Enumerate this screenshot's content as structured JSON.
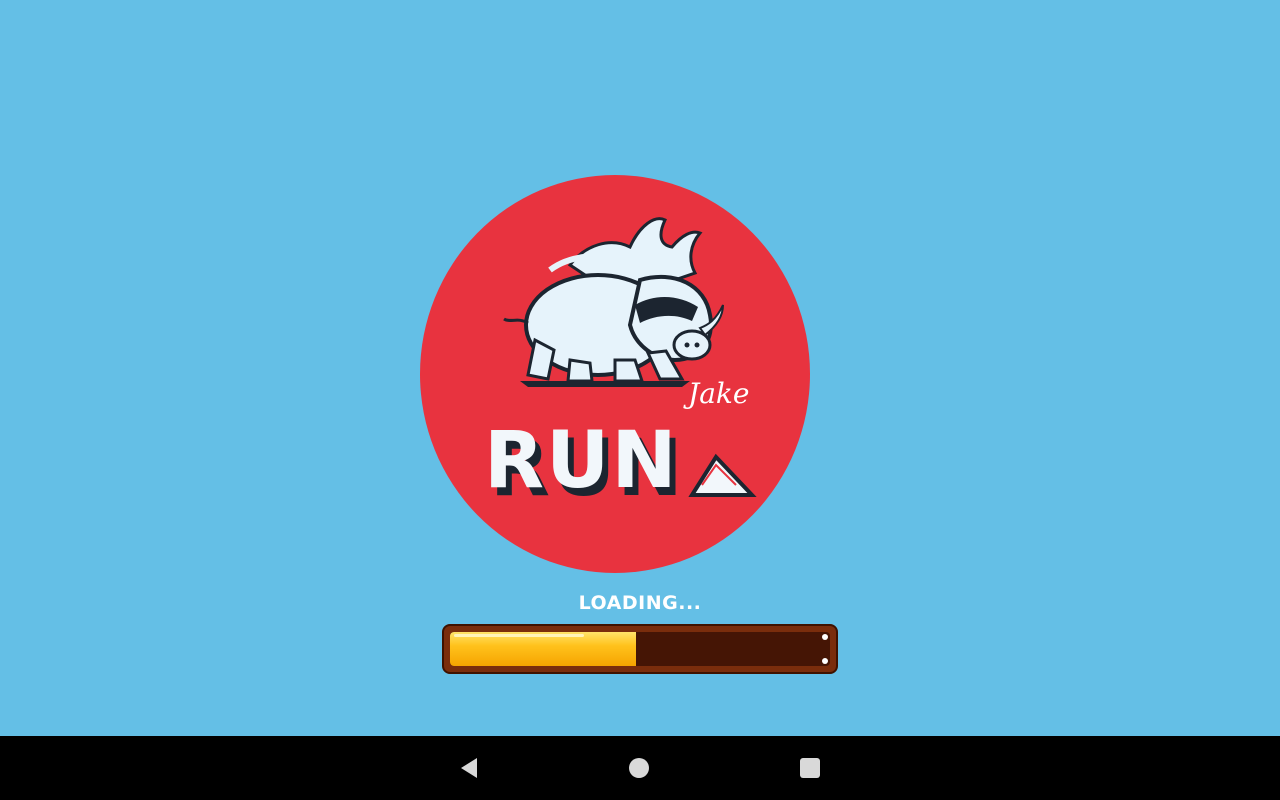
{
  "logo": {
    "title": "RUN",
    "subtitle": "Jake"
  },
  "loading": {
    "label": "LOADING...",
    "progress": 0.49
  },
  "colors": {
    "background": "#64bfe6",
    "logo_circle": "#e8333f",
    "progress_fill": "#ffc21c",
    "progress_frame": "#7a2d0c"
  },
  "nav_bar": {
    "icons": [
      "back-icon",
      "home-icon",
      "recents-icon"
    ]
  }
}
